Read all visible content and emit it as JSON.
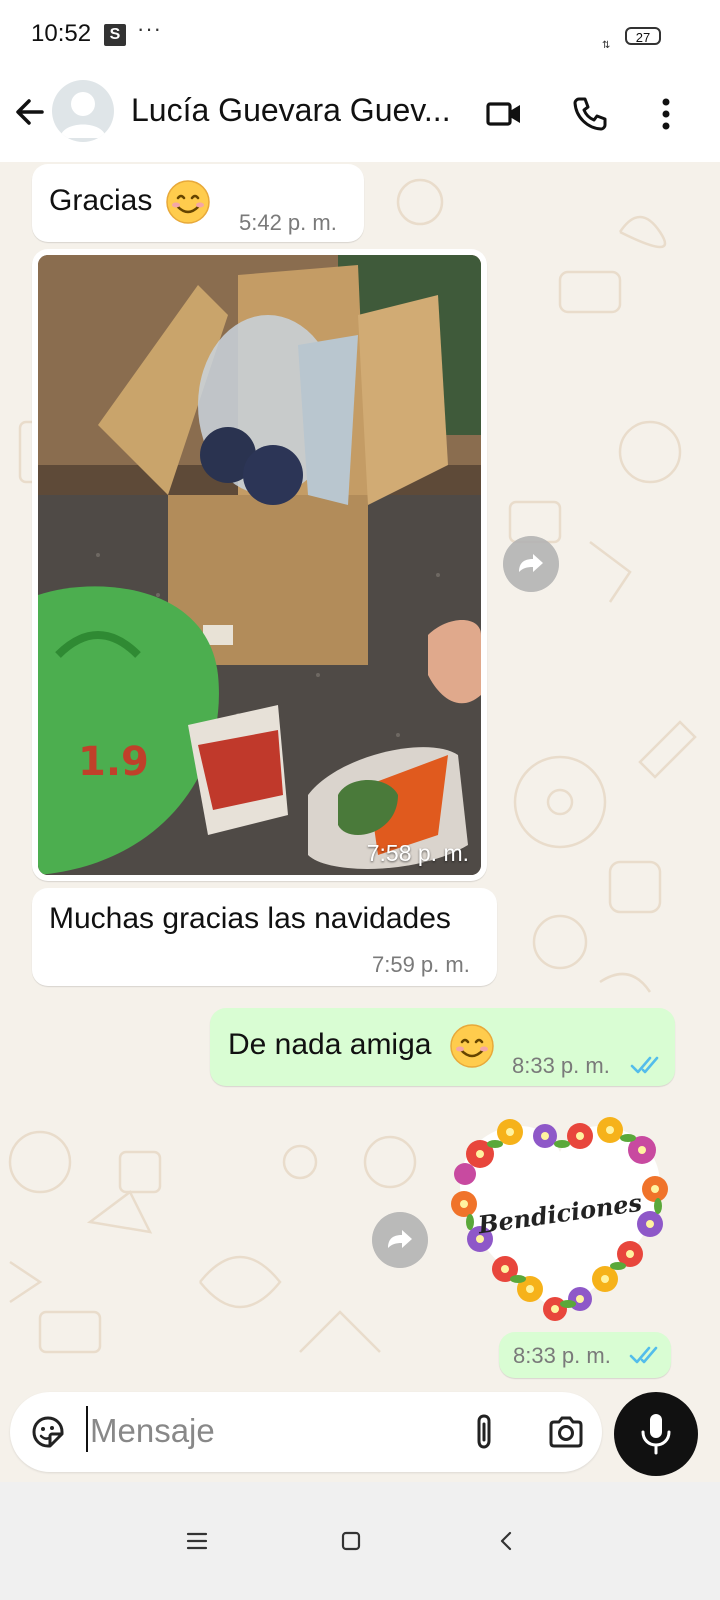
{
  "status": {
    "time": "10:52",
    "app_badge": "S",
    "more": "···",
    "battery": "27"
  },
  "header": {
    "contact_name": "Lucía Guevara Guev..."
  },
  "messages": [
    {
      "direction": "in",
      "text": "Gracias",
      "time": "5:42 p. m."
    },
    {
      "direction": "in",
      "type": "image",
      "time": "7:58 p. m."
    },
    {
      "direction": "in",
      "text": "Muchas gracias las navidades",
      "time": "7:59 p. m."
    },
    {
      "direction": "out",
      "text": "De nada amiga",
      "time": "8:33 p. m.",
      "status": "read"
    },
    {
      "direction": "out",
      "type": "sticker",
      "sticker_text": "Bendiciones",
      "time": "8:33 p. m.",
      "status": "read"
    }
  ],
  "composer": {
    "placeholder": "Mensaje"
  },
  "icons": {
    "back": "arrow-left-icon",
    "video": "video-call-icon",
    "call": "phone-icon",
    "menu": "more-vert-icon",
    "emoji": "sticker-icon",
    "attach": "paperclip-icon",
    "camera": "camera-icon",
    "mic": "mic-icon",
    "forward": "forward-icon",
    "read": "double-check-icon"
  },
  "colors": {
    "incoming": "#ffffff",
    "outgoing": "#d9fdd3",
    "read_ticks": "#53bdeb",
    "chat_bg": "#f5f1ea"
  }
}
